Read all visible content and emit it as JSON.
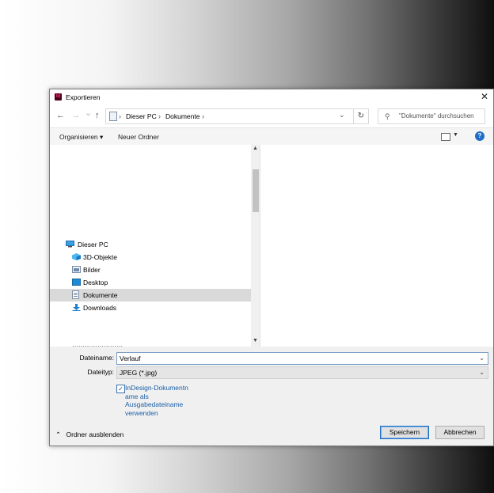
{
  "window": {
    "title": "Exportieren",
    "app_icon_text": "Id",
    "close_glyph": "✕"
  },
  "nav": {
    "back_glyph": "←",
    "forward_glyph": "→",
    "recent_glyph": "⌄",
    "up_glyph": "↑",
    "breadcrumb_sep": "›",
    "breadcrumbs": [
      "Dieser PC",
      "Dokumente"
    ],
    "address_dropdown_glyph": "⌄",
    "refresh_glyph": "↻",
    "search_placeholder": "\"Dokumente\" durchsuchen",
    "search_glyph": "⚲"
  },
  "toolbar": {
    "organize_label": "Organisieren ▾",
    "new_folder_label": "Neuer Ordner",
    "view_dropdown_glyph": "▼",
    "help_glyph": "?"
  },
  "tree": {
    "items": [
      {
        "label": "Dieser PC",
        "icon": "computer-icon",
        "selected": false
      },
      {
        "label": "3D-Objekte",
        "icon": "3d-objects-icon",
        "selected": false
      },
      {
        "label": "Bilder",
        "icon": "pictures-icon",
        "selected": false
      },
      {
        "label": "Desktop",
        "icon": "desktop-icon",
        "selected": false
      },
      {
        "label": "Dokumente",
        "icon": "documents-icon",
        "selected": true
      },
      {
        "label": "Downloads",
        "icon": "downloads-icon",
        "selected": false
      }
    ],
    "scroll_up_glyph": "▲",
    "scroll_down_glyph": "▼"
  },
  "form": {
    "filename_label": "Dateiname:",
    "filename_value": "Verlauf",
    "filetype_label": "Dateityp:",
    "filetype_value": "JPEG (*.jpg)",
    "dropdown_glyph": "⌄",
    "checkbox_checked": true,
    "checkbox_glyph": "✓",
    "checkbox_label": "InDesign-Dokumentn ame als Ausgabedateiname verwenden"
  },
  "footer": {
    "hide_folders_label": "Ordner ausblenden",
    "hide_glyph": "⌃",
    "save_label": "Speichern",
    "cancel_label": "Abbrechen"
  },
  "colors": {
    "accent": "#1c6fc4",
    "selected_row": "#d9d9d9",
    "dialog_bg": "#f0f0f0",
    "link": "#1a5fa8"
  }
}
